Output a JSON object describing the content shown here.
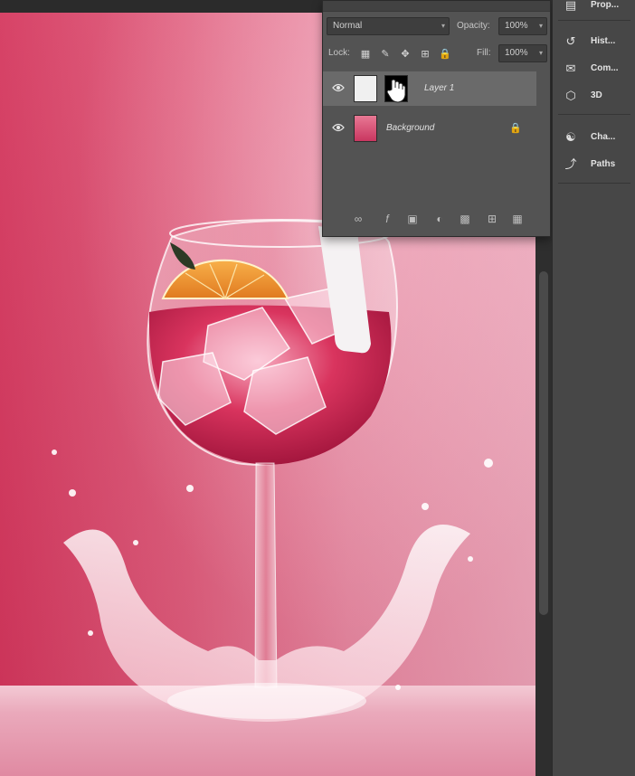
{
  "layers_panel": {
    "blend_mode": "Normal",
    "opacity_label": "Opacity:",
    "opacity_value": "100%",
    "lock_label": "Lock:",
    "fill_label": "Fill:",
    "fill_value": "100%",
    "layers": [
      {
        "name": "Layer 1",
        "selected": true,
        "visible": true
      },
      {
        "name": "Background",
        "selected": false,
        "visible": true,
        "locked": true
      }
    ],
    "footer_icons": [
      "link-icon",
      "fx-icon",
      "mask-icon",
      "adjustment-icon",
      "group-folder-icon",
      "new-layer-icon",
      "trash-icon"
    ]
  },
  "dock": {
    "items": [
      {
        "label": "Prop...",
        "icon": "properties-icon"
      },
      {
        "label": "Hist...",
        "icon": "history-icon"
      },
      {
        "label": "Com...",
        "icon": "comments-icon"
      },
      {
        "label": "3D",
        "icon": "3d-cube-icon"
      },
      {
        "label": "Cha...",
        "icon": "channels-icon"
      },
      {
        "label": "Paths",
        "icon": "paths-icon"
      }
    ]
  },
  "colors": {
    "canvas_pink": "#e0607f",
    "panel_bg": "#535353",
    "dock_bg": "#474747",
    "selected_row": "#6a6a6a"
  }
}
